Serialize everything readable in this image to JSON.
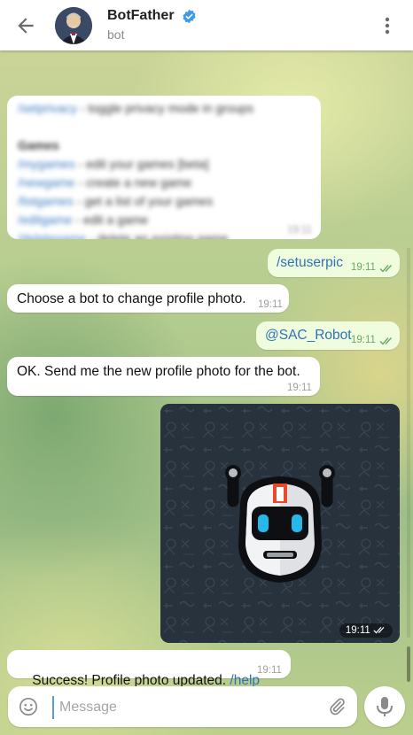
{
  "header": {
    "title": "BotFather",
    "subtitle": "bot"
  },
  "blurred_message": {
    "lines": [
      {
        "cmd": "/setprivacy",
        "text": " - toggle privacy mode in groups"
      },
      {
        "cmd": "",
        "text": ""
      },
      {
        "cmd": "",
        "text": "Games"
      },
      {
        "cmd": "/mygames",
        "text": " - edit your games [beta]"
      },
      {
        "cmd": "/newgame",
        "text": " - create a new game"
      },
      {
        "cmd": "/listgames",
        "text": " - get a list of your games"
      },
      {
        "cmd": "/editgame",
        "text": " - edit a game"
      },
      {
        "cmd": "/deletegame",
        "text": " - delete an existing game"
      }
    ],
    "time": "19:11"
  },
  "messages": [
    {
      "text": "/setuserpic",
      "time": "19:11"
    },
    {
      "text": "Choose a bot to change profile photo.",
      "time": "19:11"
    },
    {
      "text": "@SAC_Robot",
      "time": "19:11"
    },
    {
      "text": "OK. Send me the new profile photo for the bot.",
      "time": "19:11"
    },
    {
      "photo_time": "19:11"
    },
    {
      "text": "Success! Profile photo updated. ",
      "link": "/help",
      "time": "19:11"
    }
  ],
  "input": {
    "placeholder": "Message",
    "value": ""
  },
  "colors": {
    "link": "#2f73b6",
    "outgoing_bubble": "#effdde",
    "read_ticks": "#6aa865"
  },
  "icons": [
    "back-arrow-icon",
    "verified-badge-icon",
    "more-vert-icon",
    "double-check-icon",
    "emoji-icon",
    "attach-icon",
    "mic-icon"
  ]
}
